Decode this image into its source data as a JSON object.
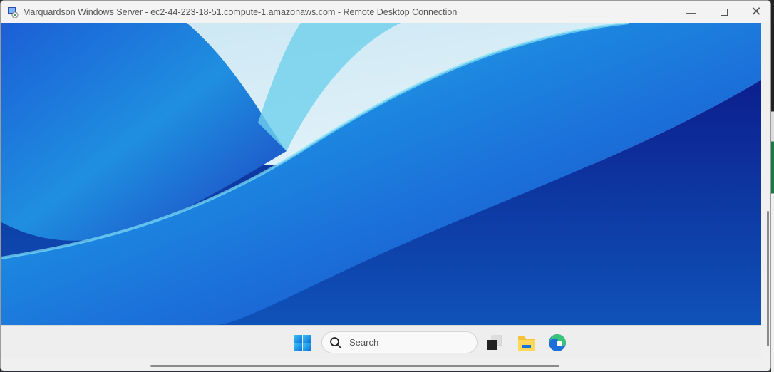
{
  "window": {
    "title": "Marquardson Windows Server - ec2-44-223-18-51.compute-1.amazonaws.com - Remote Desktop Connection",
    "controls": [
      "minimize-icon",
      "maximize-icon",
      "close-icon"
    ]
  },
  "taskbar": {
    "search_placeholder": "Search",
    "icons": [
      "windows-start-icon",
      "search-icon",
      "task-view-icon",
      "file-explorer-icon",
      "edge-icon"
    ]
  },
  "colors": {
    "accent": "#0a6fd8",
    "wallpaper_dark": "#0d2a9a",
    "wallpaper_light": "#d6ecf6"
  }
}
